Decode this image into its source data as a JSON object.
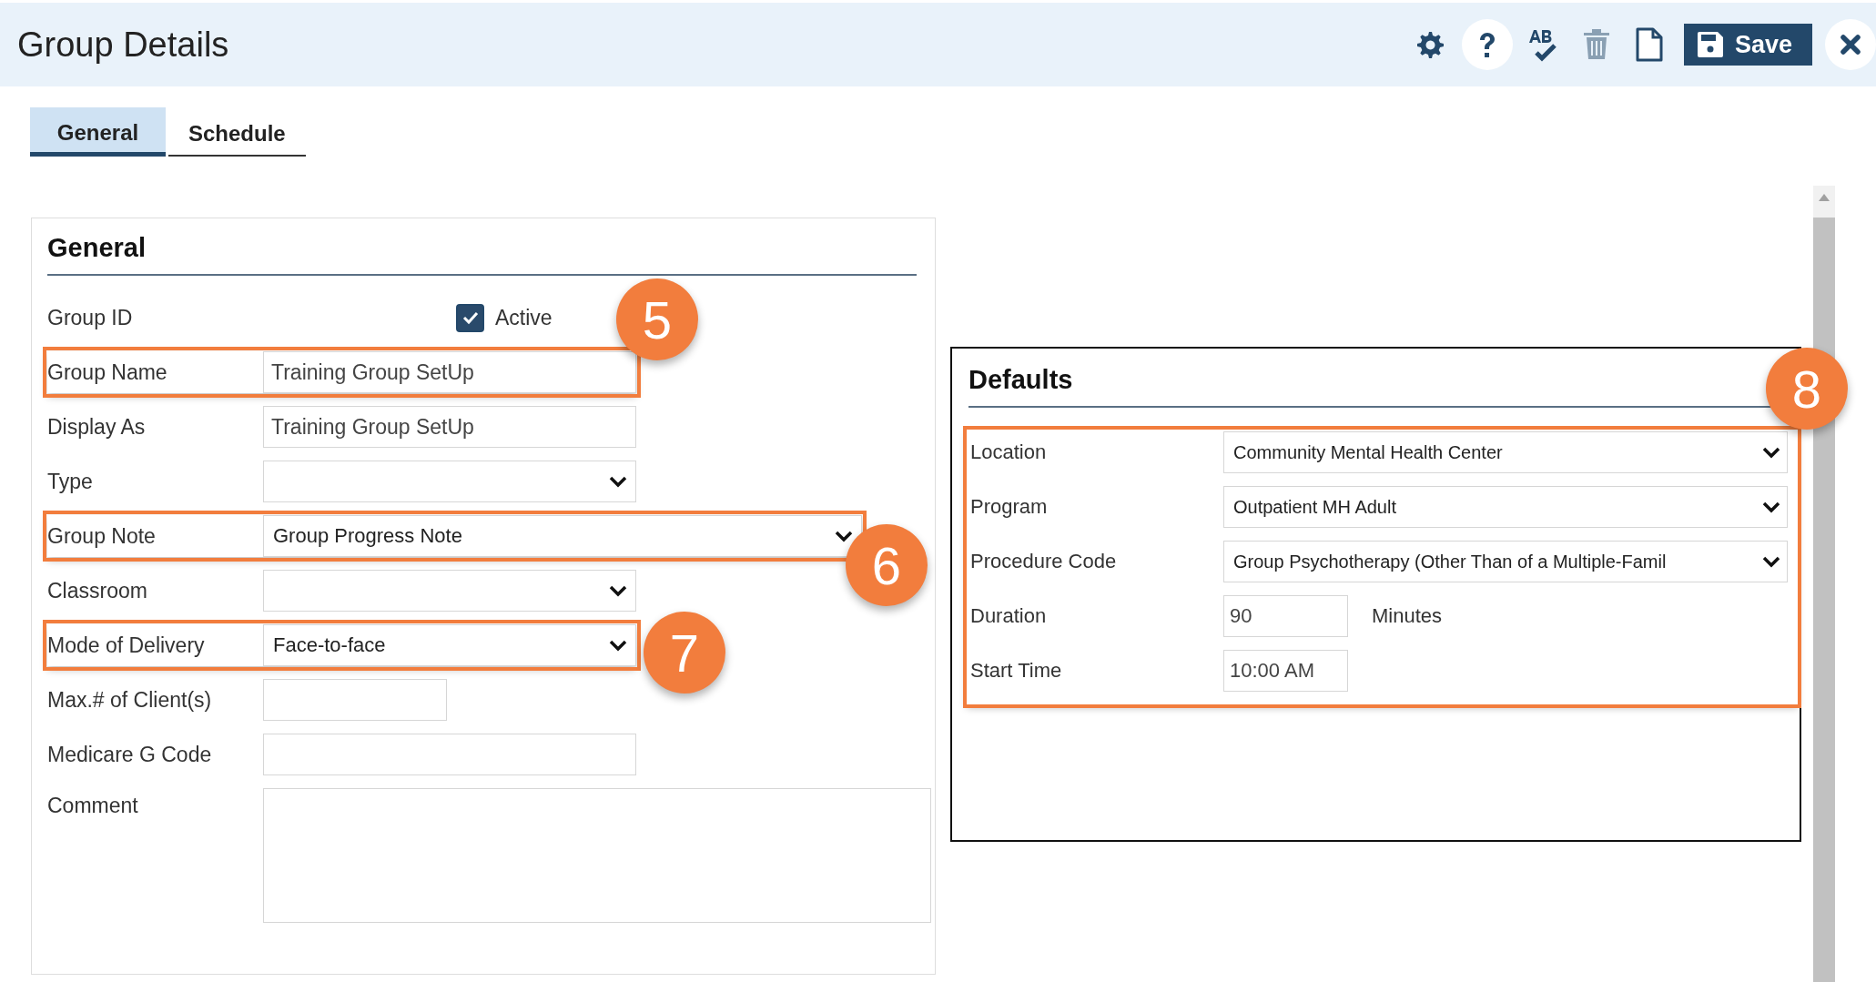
{
  "window": {
    "title": "Group Details"
  },
  "toolbar": [
    {
      "kind": "settings",
      "disabled": false
    },
    {
      "kind": "help",
      "disabled": false
    },
    {
      "kind": "spellcheck",
      "disabled": false
    },
    {
      "kind": "delete",
      "disabled": true
    },
    {
      "kind": "new",
      "disabled": false
    },
    {
      "kind": "save",
      "label": "Save",
      "disabled": false
    },
    {
      "kind": "close",
      "disabled": false
    }
  ],
  "tabs": [
    {
      "label": "General",
      "selected": true
    },
    {
      "label": "Schedule",
      "selected": false
    }
  ],
  "general": {
    "title": "General",
    "rows": [
      {
        "kind": "checkbox",
        "label": "Group ID",
        "checkbox": {
          "label": "Active",
          "checked": true
        },
        "highlighted": false
      },
      {
        "kind": "text",
        "label": "Group Name",
        "value": "Training Group SetUp",
        "highlighted": true,
        "callout": "5"
      },
      {
        "kind": "text",
        "label": "Display As",
        "value": "Training Group SetUp",
        "highlighted": false
      },
      {
        "kind": "select",
        "label": "Type",
        "highlighted": false
      },
      {
        "kind": "select",
        "label": "Group Note",
        "value": "Group Progress Note",
        "highlighted": true,
        "callout": "6"
      },
      {
        "kind": "select",
        "label": "Classroom",
        "highlighted": false
      },
      {
        "kind": "select",
        "label": "Mode of Delivery",
        "value": "Face-to-face",
        "highlighted": true,
        "callout": "7"
      },
      {
        "kind": "text",
        "label": "Max.# of Client(s)",
        "highlighted": false
      },
      {
        "kind": "text",
        "label": "Medicare G Code",
        "highlighted": false
      },
      {
        "kind": "textarea",
        "label": "Comment",
        "highlighted": false
      }
    ]
  },
  "defaults": {
    "title": "Defaults",
    "highlighted": true,
    "callout": "8",
    "rows": [
      {
        "kind": "select",
        "label": "Location",
        "value": "Community Mental Health Center"
      },
      {
        "kind": "select",
        "label": "Program",
        "value": "Outpatient MH Adult"
      },
      {
        "kind": "select",
        "label": "Procedure Code",
        "value": "Group Psychotherapy (Other Than of a Multiple-Famil"
      },
      {
        "kind": "text",
        "label": "Duration",
        "value": "90",
        "unit": "Minutes"
      },
      {
        "kind": "text",
        "label": "Start Time",
        "value": "10:00 AM"
      }
    ]
  }
}
